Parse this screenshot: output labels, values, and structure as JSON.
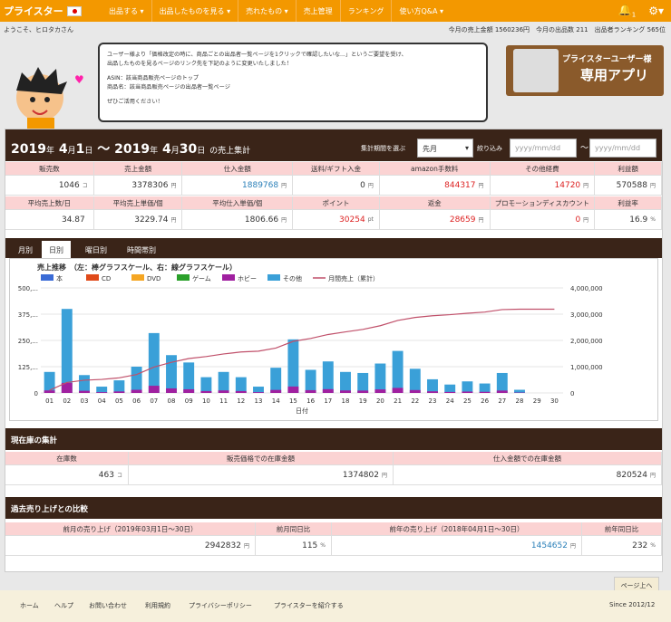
{
  "nav": {
    "logo": "プライスター",
    "items": [
      "出品する ▾",
      "出品したものを見る ▾",
      "売れたもの ▾",
      "売上管理",
      "ランキング",
      "使い方Q&A ▾"
    ],
    "bell_count": "1"
  },
  "welcome": "ようこそ、ヒロタカさん",
  "stats": "今月の売上金額 1560236円　今月の出品数 211　出品者ランキング 565位",
  "notice": [
    "ユーザー様より「価格改定の時に、商品ごとの出品者一覧ページを1クリックで確認したいな...」というご要望を受け、",
    "出品したものを見るページのリンク先を下記のように変更いたしました！",
    "",
    "ASIN：該当商品販売ページのトップ",
    "商品名：該当商品販売ページの出品者一覧ページ",
    "",
    "ぜひご活用ください！"
  ],
  "banner": {
    "line1": "プライスターユーザー様",
    "line2": "専用アプリ"
  },
  "summary": {
    "y1": "2019",
    "m1": "4",
    "d1": "1",
    "y2": "2019",
    "m2": "4",
    "d2": "30",
    "suffix": "の売上集計",
    "period_label": "集計期間を選ぶ",
    "period": "先月",
    "filter": "絞り込み",
    "ph": "yyyy/mm/dd",
    "tilde": "〜",
    "nen": "年",
    "gatsu": "月",
    "nichi": "日",
    "sep": "〜"
  },
  "metrics1": {
    "h": [
      "販売数",
      "売上金額",
      "仕入金額",
      "送料/ギフト入金",
      "amazon手数料",
      "その他経費",
      "利益額"
    ],
    "v": [
      "1046",
      "3378306",
      "1889768",
      "0",
      "844317",
      "14720",
      "570588"
    ],
    "u": [
      "コ",
      "円",
      "円",
      "円",
      "円",
      "円",
      "円"
    ]
  },
  "metrics2": {
    "h": [
      "平均売上数/日",
      "平均売上単価/個",
      "平均仕入単価/個",
      "ポイント",
      "返金",
      "プロモーションディスカウント",
      "利益率"
    ],
    "v": [
      "34.87",
      "3229.74",
      "1806.66",
      "30254",
      "28659",
      "0",
      "16.9"
    ],
    "u": [
      "",
      "円",
      "円",
      "pt",
      "円",
      "円",
      "%"
    ]
  },
  "tabs": [
    "月別",
    "日別",
    "曜日別",
    "時間帯別"
  ],
  "chart_data": {
    "type": "bar",
    "title": "売上推移　（左：棒グラフスケール、右：線グラフスケール）",
    "xlabel": "日付",
    "legend": [
      "本",
      "CD",
      "DVD",
      "ゲーム",
      "ホビー",
      "その他",
      "月間売上（累計）"
    ],
    "colors": [
      "#3a6bd6",
      "#e04a1a",
      "#f5a623",
      "#2aa02a",
      "#a020a0",
      "#3aa0d8",
      "#c0506a"
    ],
    "categories": [
      "01",
      "02",
      "03",
      "04",
      "05",
      "06",
      "07",
      "08",
      "09",
      "10",
      "11",
      "12",
      "13",
      "14",
      "15",
      "16",
      "17",
      "18",
      "19",
      "20",
      "21",
      "22",
      "23",
      "24",
      "25",
      "26",
      "27",
      "28",
      "29",
      "30"
    ],
    "values": [
      100,
      400,
      85,
      30,
      60,
      125,
      285,
      180,
      145,
      75,
      100,
      75,
      30,
      120,
      255,
      110,
      150,
      100,
      95,
      140,
      200,
      115,
      65,
      40,
      55,
      45,
      95,
      15,
      0,
      0
    ],
    "cumulative": [
      100000,
      400000,
      485000,
      515000,
      575000,
      700000,
      985000,
      1165000,
      1310000,
      1385000,
      1485000,
      1560000,
      1590000,
      1710000,
      1965000,
      2075000,
      2225000,
      2325000,
      2420000,
      2560000,
      2760000,
      2875000,
      2940000,
      2980000,
      3035000,
      3080000,
      3175000,
      3190000,
      3190000,
      3190000
    ],
    "ylim": [
      0,
      500
    ],
    "y2lim": [
      0,
      4000000
    ],
    "yticks": [
      "0",
      "125,...",
      "250,...",
      "375,...",
      "500,..."
    ],
    "y2ticks": [
      "0",
      "1,000,000",
      "2,000,000",
      "3,000,000",
      "4,000,000"
    ]
  },
  "stock": {
    "title": "現在庫の集計",
    "h": [
      "在庫数",
      "販売価格での在庫金額",
      "仕入金額での在庫金額"
    ],
    "v": [
      "463",
      "1374802",
      "820524"
    ],
    "u": [
      "コ",
      "円",
      "円"
    ]
  },
  "compare": {
    "title": "過去売り上げとの比較",
    "h": [
      "前月の売り上げ（2019年03月1日〜30日）",
      "前月同日比",
      "前年の売り上げ（2018年04月1日〜30日）",
      "前年同日比"
    ],
    "v": [
      "2942832",
      "115",
      "1454652",
      "232"
    ],
    "u": [
      "円",
      "%",
      "円",
      "%"
    ]
  },
  "toplink": "ページ上へ",
  "footer": {
    "links": [
      "ホーム",
      "ヘルプ",
      "お問い合わせ",
      "利用規約",
      "プライバシーポリシー",
      "プライスターを紹介する"
    ],
    "since": "Since 2012/12"
  }
}
